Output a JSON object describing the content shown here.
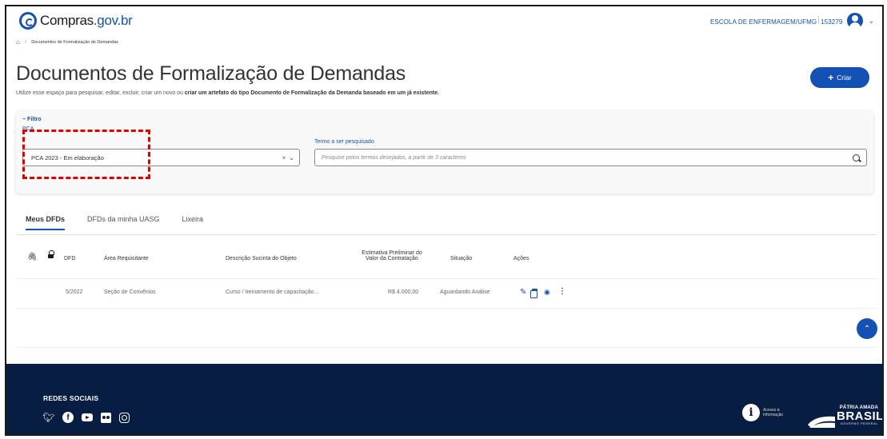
{
  "header": {
    "brand": "Compras",
    "brand_tld": ".gov.br",
    "org": "ESCOLA DE ENFERMAGEM/UFMG",
    "org_code": "153279"
  },
  "breadcrumb": {
    "current": "Documentos de Formalização de Demandas"
  },
  "page": {
    "title": "Documentos de Formalização de Demandas",
    "subtitle_prefix": "Utilize esse espaço para pesquisar, editar, excluir, criar um novo ou ",
    "subtitle_bold": "criar um artefato do tipo Documento de Formalização da Demanda baseado em um já existente.",
    "create_button": "Criar"
  },
  "filter": {
    "toggle_label": "Filtro",
    "pca_label": "PCA",
    "pca_value": "PCA 2023 - Em elaboração",
    "term_label": "Termo a ser pesquisado",
    "term_placeholder": "Pesquise pelos termos desejados, a partir de 3 caracteres"
  },
  "tabs": [
    {
      "label": "Meus DFDs",
      "active": true
    },
    {
      "label": "DFDs da minha UASG",
      "active": false
    },
    {
      "label": "Lixeira",
      "active": false
    }
  ],
  "table": {
    "headers": {
      "dfd": "DFD",
      "area": "Área Requisitante",
      "descricao": "Descrição Sucinta do Objeto",
      "estimativa_1": "Estimativa Preliminar do",
      "estimativa_2": "Valor da Contratação",
      "situacao": "Situação",
      "acoes": "Ações"
    },
    "rows": [
      {
        "dfd": "5/2022",
        "area": "Seção de Convênios",
        "descricao": "Curso / treinamento de capacitação...",
        "valor": "R$ 4.000,00",
        "situacao": "Aguardando Análise"
      }
    ]
  },
  "footer": {
    "redes_label": "REDES SOCIAIS",
    "social_icons": [
      "twitter-icon",
      "facebook-icon",
      "youtube-icon",
      "flickr-icon",
      "instagram-icon"
    ],
    "acesso_1": "Acesso à",
    "acesso_2": "Informação",
    "brasil_small": "PÁTRIA AMADA",
    "brasil_big": "BRASIL",
    "brasil_gov": "GOVERNO FEDERAL"
  },
  "colors": {
    "primary": "#1351b4",
    "footer_bg": "#071d41",
    "highlight": "#e00000"
  }
}
